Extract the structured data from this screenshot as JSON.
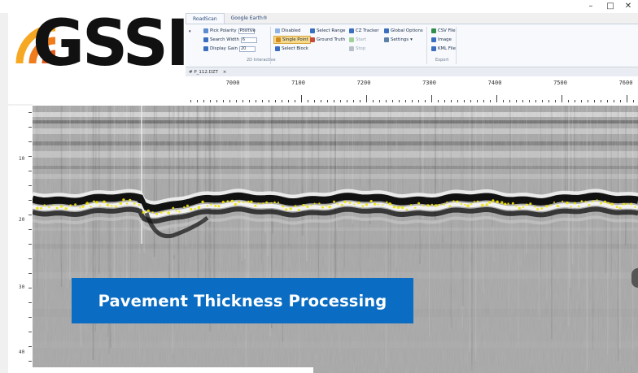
{
  "logo": {
    "text": "GSSI",
    "mark_colors": [
      "#f7a823",
      "#ef7d1d",
      "#e05a1a"
    ]
  },
  "window_controls": {
    "minimize": "–",
    "maximize": "□",
    "close": "✕"
  },
  "ribbon": {
    "tabs": [
      "RoadScan",
      "Google Earth®"
    ],
    "active_tab": "RoadScan",
    "items": {
      "pick_polarity": "Pick Polarity",
      "pick_polarity_value": "Positive",
      "search_width": "Search Width",
      "search_width_value": "6",
      "display_gain": "Display Gain",
      "display_gain_value": "20",
      "disabled": "Disabled",
      "single_point": "Single Point",
      "select_block": "Select Block",
      "select_range": "Select Range",
      "ground_truth": "Ground Truth",
      "cz_tracker": "CZ Tracker",
      "start": "Start",
      "stop": "Stop",
      "global_options": "Global Options",
      "settings": "Settings",
      "csv_file": "CSV File",
      "image": "Image",
      "kml_file": "KML File"
    },
    "groups": {
      "interactive": "2D Interactive",
      "export": "Export"
    }
  },
  "document_tab": {
    "label": "# P_112.DZT",
    "close": "×"
  },
  "ruler": {
    "labels": [
      "7000",
      "7100",
      "7200",
      "7300",
      "7400",
      "7500",
      "7600"
    ]
  },
  "depth_axis": {
    "labels": [
      "10",
      "20",
      "30",
      "40"
    ]
  },
  "banner": {
    "text": "Pavement Thickness Processing",
    "color": "#0a6cc2"
  },
  "colors": {
    "pick_marker": "#f2e600",
    "ribbon_bg": "#f7f9fc",
    "accent": "#2b4a7a"
  }
}
